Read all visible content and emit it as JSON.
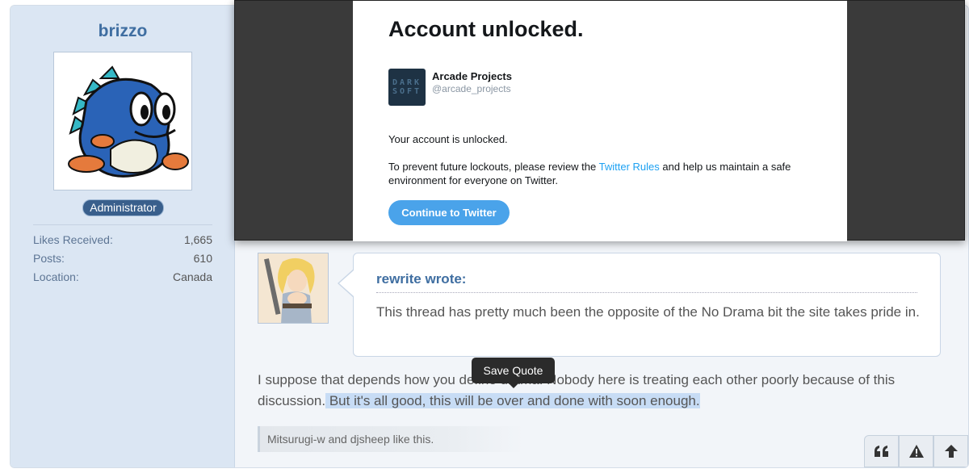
{
  "user": {
    "name": "brizzo",
    "role": "Administrator",
    "stats": [
      {
        "label": "Likes Received:",
        "value": "1,665"
      },
      {
        "label": "Posts:",
        "value": "610"
      },
      {
        "label": "Location:",
        "value": "Canada"
      }
    ]
  },
  "popup": {
    "title": "Account unlocked.",
    "account_name": "Arcade Projects",
    "account_handle": "@arcade_projects",
    "logo_text": "DARK SOFT",
    "message1": "Your account is unlocked.",
    "message2_before": "To prevent future lockouts, please review the ",
    "message2_link": "Twitter Rules",
    "message2_after": " and help us maintain a safe environment for everyone on Twitter.",
    "button_label": "Continue to Twitter"
  },
  "quote": {
    "author": "rewrite wrote:",
    "text": "This thread has pretty much been the opposite of the No Drama bit the site takes pride in."
  },
  "message": {
    "text_before": "I suppose that depends how you define drama. Nobody here is treating each other poorly because of this discussion.",
    "text_highlight": " But it's all good, this will be over and done with soon enough. "
  },
  "tooltip": {
    "label": "Save Quote"
  },
  "likes": {
    "text": "Mitsurugi-w and djsheep like this."
  },
  "actions": [
    {
      "icon": "quote-icon"
    },
    {
      "icon": "warning-icon"
    },
    {
      "icon": "arrow-up-icon"
    }
  ]
}
